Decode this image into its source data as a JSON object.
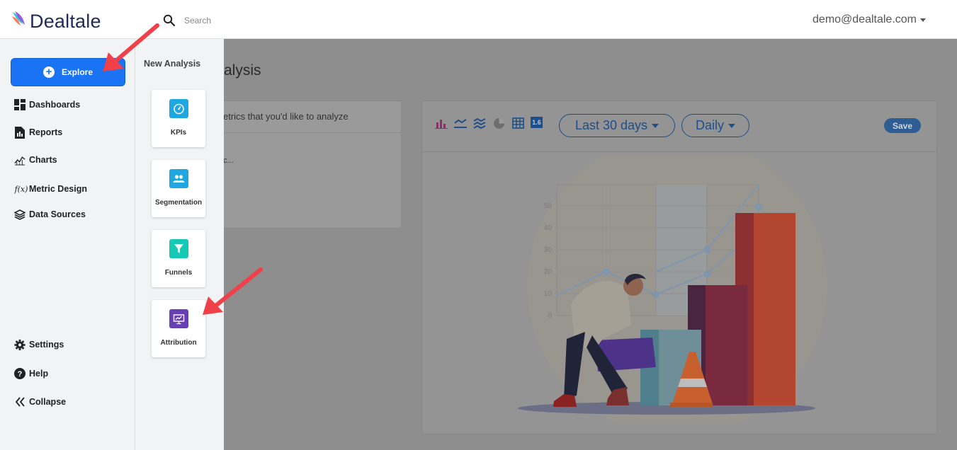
{
  "app": {
    "logo_text": "Dealtale"
  },
  "search": {
    "placeholder": "Search"
  },
  "user": {
    "email": "demo@dealtale.com"
  },
  "sidebar": {
    "explore_label": "Explore",
    "items": [
      {
        "label": "Dashboards"
      },
      {
        "label": "Reports"
      },
      {
        "label": "Charts"
      },
      {
        "label": "Metric Design"
      },
      {
        "label": "Data Sources"
      }
    ],
    "bottom_items": [
      {
        "label": "Settings"
      },
      {
        "label": "Help"
      },
      {
        "label": "Collapse"
      }
    ]
  },
  "flyout": {
    "title": "New Analysis",
    "tiles": [
      {
        "label": "KPIs",
        "color": "#1ea7e0"
      },
      {
        "label": "Segmentation",
        "color": "#1ea7e0"
      },
      {
        "label": "Funnels",
        "color": "#16c9b5"
      },
      {
        "label": "Attribution",
        "color": "#6a3fb5"
      }
    ]
  },
  "main": {
    "title": "alysis",
    "card_hint": "etrics that you'd like to analyze",
    "card_sub": "c..."
  },
  "chart_toolbar": {
    "date_range": "Last 30 days",
    "granularity": "Daily",
    "save_label": "Save",
    "table_number_icon_text": "1.6"
  },
  "illustration": {
    "y_ticks": [
      "50",
      "40",
      "30",
      "20",
      "10",
      "0"
    ]
  },
  "colors": {
    "accent": "#1a73f5",
    "brand_navy": "#1f2a55",
    "annotation_arrow": "#f0404a"
  }
}
